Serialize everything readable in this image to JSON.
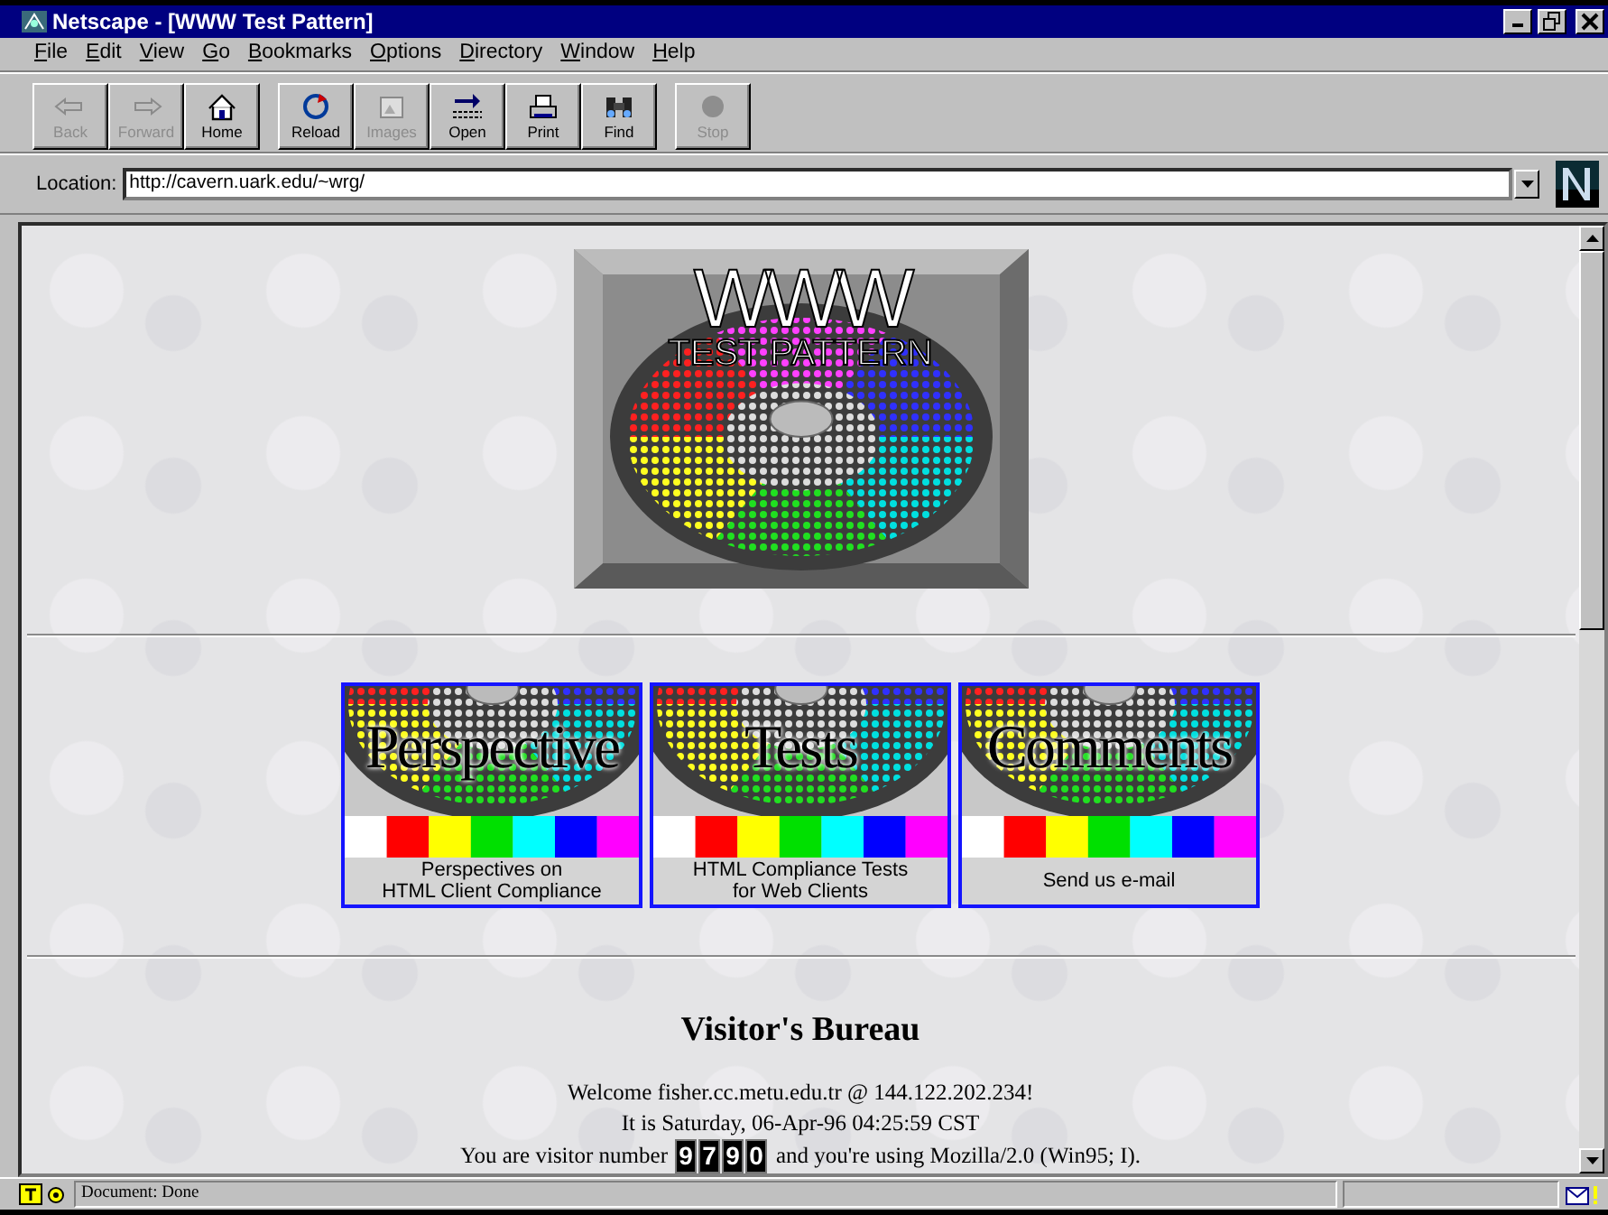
{
  "window": {
    "title": "Netscape - [WWW Test Pattern]"
  },
  "menu": [
    "File",
    "Edit",
    "View",
    "Go",
    "Bookmarks",
    "Options",
    "Directory",
    "Window",
    "Help"
  ],
  "toolbar": [
    [
      {
        "label": "Back",
        "disabled": true
      },
      {
        "label": "Forward",
        "disabled": true
      },
      {
        "label": "Home",
        "disabled": false
      }
    ],
    [
      {
        "label": "Reload",
        "disabled": false
      },
      {
        "label": "Images",
        "disabled": true
      },
      {
        "label": "Open",
        "disabled": false
      },
      {
        "label": "Print",
        "disabled": false
      },
      {
        "label": "Find",
        "disabled": false
      }
    ],
    [
      {
        "label": "Stop",
        "disabled": true
      }
    ]
  ],
  "location": {
    "label": "Location:",
    "value": "http://cavern.uark.edu/~wrg/"
  },
  "page": {
    "logo": {
      "title": "WWW",
      "subtitle": "TEST PATTERN"
    },
    "links": [
      {
        "word": "Perspective",
        "caption": [
          "Perspectives on",
          "HTML Client Compliance"
        ]
      },
      {
        "word": "Tests",
        "caption": [
          "HTML Compliance Tests",
          "for Web Clients"
        ]
      },
      {
        "word": "Comments",
        "caption": [
          "Send us e-mail"
        ]
      }
    ],
    "heading": "Visitor's Bureau",
    "lines": [
      "Welcome fisher.cc.metu.edu.tr @ 144.122.202.234!",
      "It is Saturday, 06-Apr-96 04:25:59 CST"
    ],
    "visitor": {
      "before": "You are visitor number",
      "digits": [
        "9",
        "7",
        "9",
        "0"
      ],
      "after": "and you're using Mozilla/2.0 (Win95; I)."
    }
  },
  "status_bar": {
    "text": "Document: Done"
  }
}
